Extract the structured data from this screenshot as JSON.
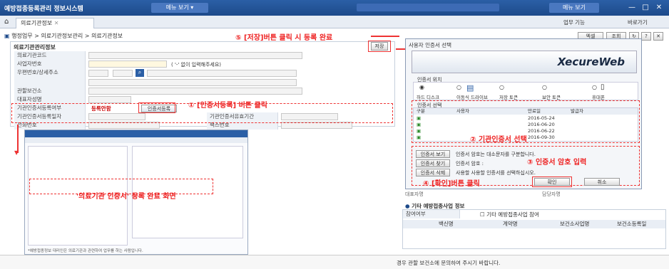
{
  "app": {
    "title": "예방접종등록관리 정보시스템",
    "menu_pill": "메뉴 보기",
    "right_pill": "메뉴 보기"
  },
  "tabs": [
    {
      "label": "의료기관정보"
    }
  ],
  "right_tabs": {
    "menu1": "업무 기능",
    "menu2": "바로가기"
  },
  "breadcrumb": "행정업무 > 의료기관정보관리 > 의료기관정보",
  "toolbar": {
    "btn1": "엑셀",
    "btn2": "조회"
  },
  "main": {
    "section_title": "의료기관관리정보",
    "save_label": "저장",
    "rows": [
      {
        "label": "의료기관코드"
      },
      {
        "label": "사업자번호",
        "hint": "( '-' 없이 입력해주세요)"
      },
      {
        "label": "우편번호/상세주소"
      },
      {
        "label": "관할보건소"
      },
      {
        "label": "대표자성명"
      },
      {
        "label": "기관인증서등록여부",
        "status": "등록안함",
        "btn": "인증서등록"
      },
      {
        "label": "기관인증서등록일자",
        "label2": "기관인증서유효기간"
      },
      {
        "label": "전화번호",
        "label2": "팩스번호"
      }
    ]
  },
  "annotations": {
    "a1": "① [인증서등록] 버튼 클릭",
    "a2": "② 기관인증서 선택",
    "a3": "③ 인증서 암호 입력",
    "a4": "④ [확인]버튼 클릭",
    "a5": "⑤ [저장]버튼 클릭 시 등록 완료",
    "mini_caption": "'의료기관 인증서' 등록 완료 화면"
  },
  "dialog": {
    "title": "사용자 인증서 선택",
    "brand": "XecureWeb",
    "location_label": "인증서 위치",
    "locations": [
      "하드 디스크",
      "이동식 드라이브",
      "저장 토큰",
      "보안 토큰",
      "휴대폰"
    ],
    "cert_label": "인증서 선택",
    "columns": [
      "구분",
      "사용자",
      "만료일",
      "발급자"
    ],
    "certs": [
      {
        "date": "2016-05-24"
      },
      {
        "date": "2016-06-20"
      },
      {
        "date": "2016-06-22"
      },
      {
        "date": "2016-09-30"
      }
    ],
    "btn_view": "인증서 보기",
    "btn_find": "인증서 찾기",
    "btn_delete": "인증서 삭제",
    "msg_top": "인증서 암호는 대소문자를 구분합니다.",
    "pw_label": "인증서 암호 :",
    "msg_bottom": "사용할 사용할 인증서를 선택하십시오.",
    "ok": "확인",
    "cancel": "취소"
  },
  "other": {
    "title": "기타 예방접종사업 정보",
    "join_label": "참여여부",
    "checkbox_label": "기타 예방접종사업 참여",
    "columns": [
      "백신명",
      "계약명",
      "보건소사업명",
      "보건소등록일"
    ],
    "side_label1": "대표자명",
    "side_label2": "담당자명"
  },
  "footer_text": "경우 관할 보건소에 문의하여 주시기 바랍니다.",
  "mini": {
    "bottom_note": "*예방접종정보 대리인은 의료기관과 관련하여 업무를 하는 사람입니다."
  }
}
